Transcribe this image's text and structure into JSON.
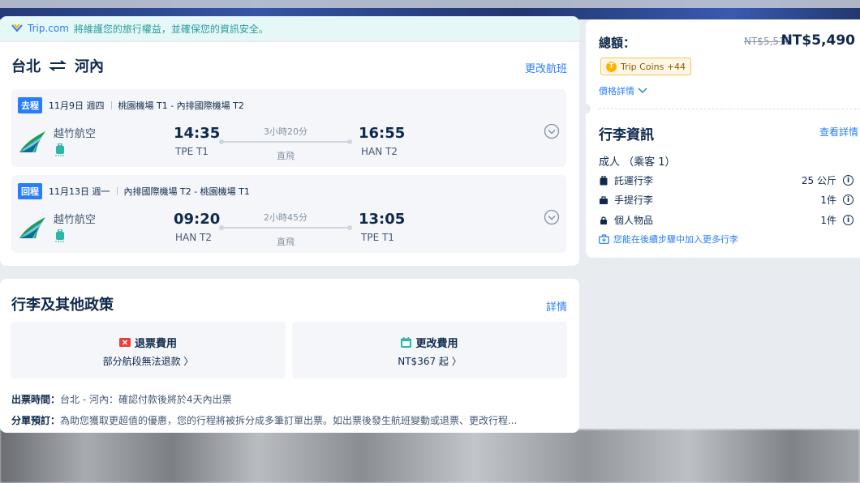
{
  "notice": {
    "brand": "Trip.com",
    "text": "將維護您的旅行權益，並確保您的資訊安全。"
  },
  "route": {
    "from": "台北",
    "to": "河內",
    "change_label": "更改航班"
  },
  "legs": [
    {
      "tag": "去程",
      "date": "11月9日 週四",
      "airports": "桃園機場 T1 - 內排國際機場 T2",
      "airline": "越竹航空",
      "dep_time": "14:35",
      "dep_airport": "TPE T1",
      "duration": "3小時20分",
      "stops": "直飛",
      "arr_time": "16:55",
      "arr_airport": "HAN T2"
    },
    {
      "tag": "回程",
      "date": "11月13日 週一",
      "airports": "內排國際機場 T2 - 桃園機場 T1",
      "airline": "越竹航空",
      "dep_time": "09:20",
      "dep_airport": "HAN T2",
      "duration": "2小時45分",
      "stops": "直飛",
      "arr_time": "13:05",
      "arr_airport": "TPE T1"
    }
  ],
  "policy": {
    "title": "行李及其他政策",
    "detail_label": "詳情",
    "refund": {
      "title": "退票費用",
      "sub": "部分航段無法退款 〉"
    },
    "change": {
      "title": "更改費用",
      "sub": "NT$367 起 〉"
    },
    "ticketing_label": "出票時間：",
    "ticketing_text": "台北 - 河內：確認付款後將於4天內出票",
    "split_label": "分單預訂：",
    "split_text": "為助您獲取更超值的優惠，您的行程將被拆分成多筆訂單出票。如出票後發生航班變動或退票、更改行程..."
  },
  "summary": {
    "total_label": "總額：",
    "original_price": "NT$5,510",
    "price": "NT$5,490",
    "coins": "Trip Coins +44",
    "price_detail_label": "價格詳情"
  },
  "baggage": {
    "title": "行李資訊",
    "view_label": "查看詳情",
    "passenger": "成人 （乘客 1）",
    "items": [
      {
        "name": "託運行李",
        "value": "25 公斤",
        "icon": "suitcase-icon"
      },
      {
        "name": "手提行李",
        "value": "1件",
        "icon": "carry-on-icon"
      },
      {
        "name": "個人物品",
        "value": "1件",
        "icon": "personal-item-icon"
      }
    ],
    "add_more": "您能在後續步驟中加入更多行李"
  },
  "colors": {
    "accent": "#287dfa",
    "text": "#0f294d",
    "notice_bg": "#e6f7f7",
    "coin": "#ffb400"
  }
}
